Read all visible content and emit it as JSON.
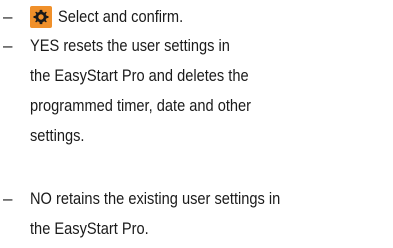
{
  "items": [
    {
      "dash": "–",
      "icon": "settings-gear-icon",
      "lines": [
        "Select and confirm."
      ]
    },
    {
      "dash": "–",
      "lines": [
        "YES resets the user settings in",
        "the EasyStart Pro and deletes the",
        "programmed timer, date and other",
        "settings."
      ]
    },
    {
      "dash": "–",
      "lines": [
        "NO retains the existing user settings in",
        "the EasyStart Pro."
      ]
    }
  ],
  "colors": {
    "icon_background": "#f0902a",
    "icon_foreground": "#1a1a1a",
    "text": "#1a1a1a"
  }
}
